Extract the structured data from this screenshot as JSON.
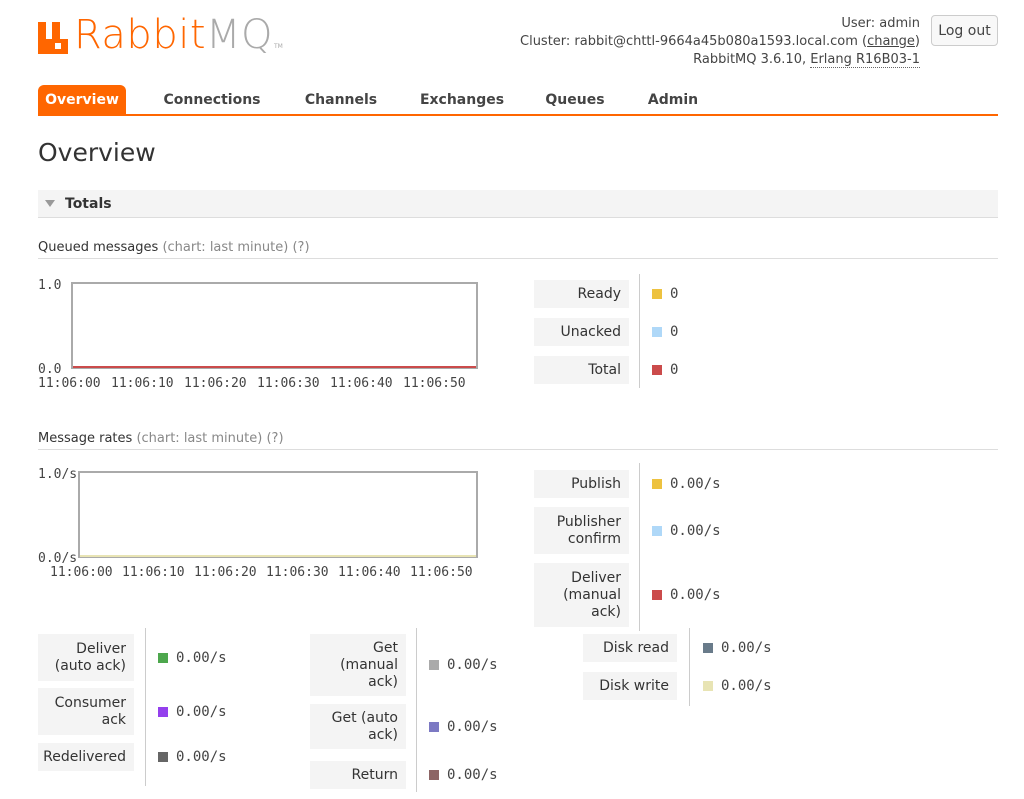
{
  "header": {
    "logo_main": "Rabbit",
    "logo_mq": "MQ",
    "logo_tm": "TM",
    "user_label": "User: admin",
    "cluster_prefix": "Cluster: rabbit@chttl-9664a45b080a1593.local.com (",
    "cluster_change": "change",
    "cluster_suffix": ")",
    "version_prefix": "RabbitMQ 3.6.10, ",
    "erlang": "Erlang R16B03-1",
    "logout": "Log out"
  },
  "tabs": [
    "Overview",
    "Connections",
    "Channels",
    "Exchanges",
    "Queues",
    "Admin"
  ],
  "page_title": "Overview",
  "section_title": "Totals",
  "queued": {
    "title": "Queued messages",
    "chart_note": "(chart: last minute)",
    "help": "(?)",
    "stats": [
      {
        "label": "Ready",
        "value": "0",
        "color": "#edc240"
      },
      {
        "label": "Unacked",
        "value": "0",
        "color": "#afd8f8"
      },
      {
        "label": "Total",
        "value": "0",
        "color": "#cb4b4b"
      }
    ]
  },
  "rates": {
    "title": "Message rates",
    "chart_note": "(chart: last minute)",
    "help": "(?)",
    "stats_right": [
      {
        "label": "Publish",
        "value": "0.00/s",
        "color": "#edc240"
      },
      {
        "label": "Publisher confirm",
        "value": "0.00/s",
        "color": "#afd8f8"
      },
      {
        "label": "Deliver (manual ack)",
        "value": "0.00/s",
        "color": "#cb4b4b"
      }
    ],
    "col1": [
      {
        "label": "Deliver (auto ack)",
        "value": "0.00/s",
        "color": "#4da74d"
      },
      {
        "label": "Consumer ack",
        "value": "0.00/s",
        "color": "#9440ed"
      },
      {
        "label": "Redelivered",
        "value": "0.00/s",
        "color": "#666666"
      }
    ],
    "col2": [
      {
        "label": "Get (manual ack)",
        "value": "0.00/s",
        "color": "#aaaaaa"
      },
      {
        "label": "Get (auto ack)",
        "value": "0.00/s",
        "color": "#7c79c3"
      },
      {
        "label": "Return",
        "value": "0.00/s",
        "color": "#8d6565"
      }
    ],
    "col3": [
      {
        "label": "Disk read",
        "value": "0.00/s",
        "color": "#697b8a"
      },
      {
        "label": "Disk write",
        "value": "0.00/s",
        "color": "#e8e4b4"
      }
    ]
  },
  "chart_data": [
    {
      "type": "line",
      "x": [
        "11:06:00",
        "11:06:10",
        "11:06:20",
        "11:06:30",
        "11:06:40",
        "11:06:50"
      ],
      "ylim": [
        0.0,
        1.0
      ],
      "ytick_labels": [
        "0.0",
        "1.0"
      ],
      "series": [
        {
          "name": "Ready",
          "values": [
            0,
            0,
            0,
            0,
            0,
            0
          ],
          "color": "#edc240"
        },
        {
          "name": "Unacked",
          "values": [
            0,
            0,
            0,
            0,
            0,
            0
          ],
          "color": "#afd8f8"
        },
        {
          "name": "Total",
          "values": [
            0,
            0,
            0,
            0,
            0,
            0
          ],
          "color": "#cb4b4b"
        }
      ]
    },
    {
      "type": "line",
      "x": [
        "11:06:00",
        "11:06:10",
        "11:06:20",
        "11:06:30",
        "11:06:40",
        "11:06:50"
      ],
      "ylim": [
        0.0,
        1.0
      ],
      "ytick_labels": [
        "0.0/s",
        "1.0/s"
      ],
      "series": [
        {
          "name": "Publish",
          "values": [
            0,
            0,
            0,
            0,
            0,
            0
          ],
          "color": "#edc240"
        },
        {
          "name": "Disk write",
          "values": [
            0,
            0,
            0,
            0,
            0,
            0
          ],
          "color": "#e8e4b4"
        }
      ]
    }
  ]
}
